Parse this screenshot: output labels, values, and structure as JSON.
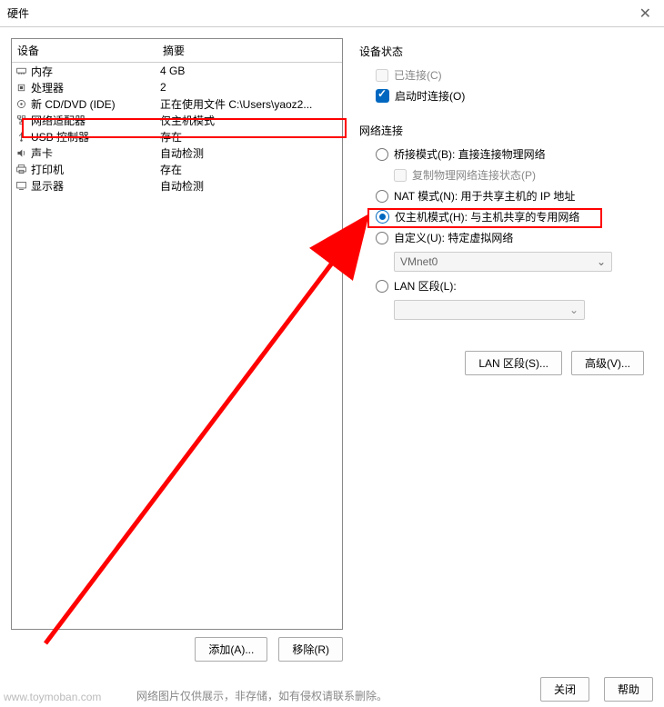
{
  "window": {
    "title": "硬件"
  },
  "table": {
    "headers": {
      "device": "设备",
      "summary": "摘要"
    },
    "rows": [
      {
        "device": "内存",
        "summary": "4 GB",
        "icon": "memory"
      },
      {
        "device": "处理器",
        "summary": "2",
        "icon": "cpu"
      },
      {
        "device": "新 CD/DVD (IDE)",
        "summary": "正在使用文件 C:\\Users\\yaoz2...",
        "icon": "disc"
      },
      {
        "device": "网络适配器",
        "summary": "仅主机模式",
        "icon": "net"
      },
      {
        "device": "USB 控制器",
        "summary": "存在",
        "icon": "usb"
      },
      {
        "device": "声卡",
        "summary": "自动检测",
        "icon": "sound"
      },
      {
        "device": "打印机",
        "summary": "存在",
        "icon": "printer"
      },
      {
        "device": "显示器",
        "summary": "自动检测",
        "icon": "display"
      }
    ]
  },
  "left_buttons": {
    "add": "添加(A)...",
    "remove": "移除(R)"
  },
  "status_group": {
    "title": "设备状态",
    "connected": "已连接(C)",
    "connect_on_start": "启动时连接(O)"
  },
  "network_group": {
    "title": "网络连接",
    "bridged": "桥接模式(B): 直接连接物理网络",
    "replicate": "复制物理网络连接状态(P)",
    "nat": "NAT 模式(N): 用于共享主机的 IP 地址",
    "hostonly": "仅主机模式(H): 与主机共享的专用网络",
    "custom": "自定义(U): 特定虚拟网络",
    "vmnet": "VMnet0",
    "lan": "LAN 区段(L):"
  },
  "right_buttons": {
    "lan_seg": "LAN 区段(S)...",
    "advanced": "高级(V)..."
  },
  "footer": {
    "close": "关闭",
    "help": "帮助"
  },
  "watermark": "www.toymoban.com",
  "caption": "网络图片仅供展示，非存储，如有侵权请联系删除。"
}
